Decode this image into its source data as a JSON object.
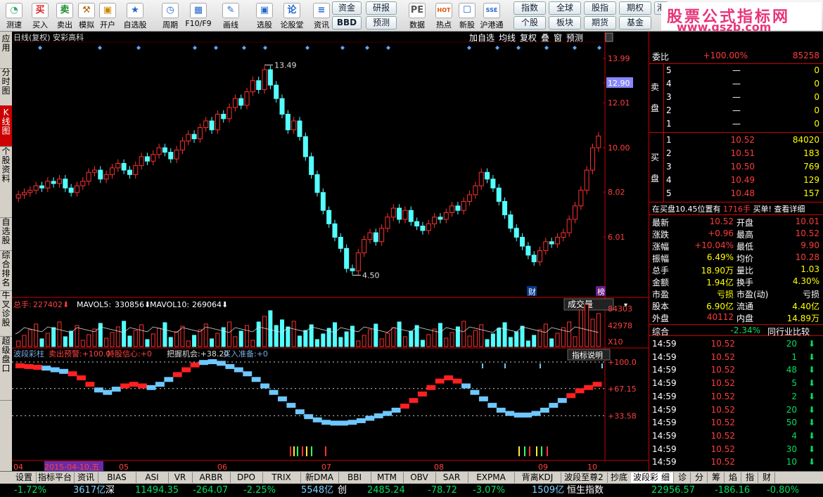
{
  "toolbar": {
    "items": [
      {
        "label": "测速",
        "icon": "speed-icon",
        "glyph": "◔",
        "color": "#3a6"
      },
      {
        "label": "买入",
        "icon": "buy-icon",
        "glyph": "买",
        "color": "#d22"
      },
      {
        "label": "卖出",
        "icon": "sell-icon",
        "glyph": "卖",
        "color": "#1a8a2a"
      },
      {
        "label": "模拟",
        "icon": "hammer-icon",
        "glyph": "⚒",
        "color": "#a60"
      },
      {
        "label": "开户",
        "icon": "lock-icon",
        "glyph": "▣",
        "color": "#c80"
      },
      {
        "label": "自选股",
        "icon": "star-icon",
        "glyph": "★",
        "color": "#26c"
      },
      {
        "label": "周期",
        "icon": "clock-icon",
        "glyph": "◷",
        "color": "#26c"
      },
      {
        "label": "F10/F9",
        "icon": "f10-icon",
        "glyph": "▦",
        "color": "#26c"
      },
      {
        "label": "画线",
        "icon": "pen-icon",
        "glyph": "✎",
        "color": "#26c"
      },
      {
        "label": "选股",
        "icon": "screen-icon",
        "glyph": "▣",
        "color": "#26c"
      },
      {
        "label": "论股堂",
        "icon": "forum-icon",
        "glyph": "论",
        "color": "#26c"
      },
      {
        "label": "资讯",
        "icon": "news-icon",
        "glyph": "≡",
        "color": "#26c"
      },
      {
        "label": "数据",
        "icon": "pe-icon",
        "glyph": "PE",
        "color": "#555"
      },
      {
        "label": "热点",
        "icon": "hot-icon",
        "glyph": "HOT",
        "color": "#d50"
      },
      {
        "label": "新股",
        "icon": "newstock-icon",
        "glyph": "☐",
        "color": "#26c"
      },
      {
        "label": "沪港通",
        "icon": "hk-connect-icon",
        "glyph": "SSE",
        "color": "#26c"
      }
    ],
    "buttons": [
      "资金",
      "研报",
      "BBD",
      "预测",
      "指数",
      "全球",
      "股指",
      "期权",
      "个股",
      "板块",
      "期货",
      "基金",
      "港"
    ]
  },
  "watermark": {
    "line1": "股票公式指标网",
    "line2": "www.gszb.com"
  },
  "left_tabs": [
    "应用",
    "分时图",
    "K线图",
    "个股资料",
    "自选股",
    "综合排名",
    "牛叉诊股",
    "超级盘口"
  ],
  "chart": {
    "title": "日线(复权) 安彩高科",
    "header_buttons": [
      "加自选",
      "均线",
      "复权",
      "叠",
      "窗",
      "预测"
    ],
    "price_axis": [
      "13.99",
      "12.90",
      "12.01",
      "10.00",
      "8.02",
      "6.01"
    ],
    "annotations": {
      "high": "13.49",
      "low": "4.50",
      "marker1": "财",
      "marker2": "榜"
    },
    "volume_header": {
      "label": "总手:",
      "total": "227402",
      "mavol5_label": "MAVOL5:",
      "mavol5": "330856",
      "mavol10_label": "MAVOL10:",
      "mavol10": "269064"
    },
    "volume_tab": "成交量",
    "volume_axis": [
      "84303",
      "42978",
      "X10"
    ],
    "indicator_header": {
      "name": "波段彩柱",
      "sell": "卖出预警:+100.0",
      "hold": "持股信心:+0",
      "wait": "把握机会:+38.20",
      "buy": "买入准备:+0"
    },
    "indicator_button": "指标说明",
    "indicator_axis": [
      "+100.0",
      "+67.15",
      "+33.58"
    ],
    "months": [
      "04",
      "2015-04-10,五",
      "05",
      "06",
      "07",
      "08",
      "09",
      "10"
    ]
  },
  "chart_data": {
    "type": "candlestick",
    "title": "日线(复权) 安彩高科",
    "xlabel": "",
    "ylabel": "",
    "ylim": [
      3.5,
      14.5
    ],
    "x": [
      "04",
      "05",
      "06",
      "07",
      "08",
      "09",
      "10"
    ],
    "series": [
      {
        "name": "总手",
        "values": [
          227402
        ]
      },
      {
        "name": "MAVOL5",
        "values": [
          330856
        ]
      },
      {
        "name": "MAVOL10",
        "values": [
          269064
        ]
      }
    ],
    "closes": [
      7.9,
      8.0,
      8.1,
      8.3,
      8.2,
      8.5,
      8.4,
      8.6,
      8.2,
      8.0,
      8.3,
      8.5,
      8.9,
      9.0,
      8.6,
      8.8,
      9.1,
      9.3,
      9.0,
      8.8,
      9.2,
      9.6,
      9.4,
      9.7,
      10.0,
      9.8,
      9.5,
      9.9,
      10.3,
      10.6,
      10.4,
      10.9,
      11.2,
      10.8,
      11.5,
      11.3,
      11.8,
      12.2,
      11.9,
      12.5,
      13.0,
      12.6,
      13.49,
      12.8,
      12.2,
      11.5,
      10.8,
      11.2,
      10.5,
      9.6,
      8.8,
      8.0,
      7.2,
      6.6,
      6.0,
      5.5,
      4.6,
      4.5,
      5.3,
      5.9,
      6.2,
      5.8,
      6.4,
      6.9,
      7.3,
      6.8,
      7.2,
      6.7,
      6.5,
      6.3,
      6.6,
      6.9,
      6.8,
      7.1,
      7.4,
      7.2,
      7.6,
      7.9,
      8.3,
      8.9,
      8.6,
      8.2,
      7.6,
      7.0,
      6.4,
      6.0,
      5.6,
      5.2,
      4.9,
      5.4,
      5.8,
      5.7,
      6.0,
      6.2,
      6.8,
      7.4,
      8.1,
      9.0,
      10.0,
      10.52
    ],
    "price_axis": [
      13.99,
      12.9,
      12.01,
      10.0,
      8.02,
      6.01
    ],
    "volume_axis": [
      84303,
      42978
    ],
    "indicator_axis": [
      100.0,
      67.15,
      33.58
    ],
    "indicator": [
      95,
      94,
      93,
      92,
      90,
      88,
      85,
      80,
      72,
      65,
      62,
      66,
      70,
      72,
      70,
      68,
      72,
      78,
      84,
      90,
      96,
      99,
      100,
      98,
      94,
      90,
      85,
      78,
      70,
      62,
      54,
      46,
      38,
      32,
      28,
      25,
      24,
      24,
      25,
      27,
      30,
      33,
      36,
      40,
      45,
      52,
      60,
      68,
      76,
      80,
      76,
      70,
      62,
      54,
      46,
      40,
      36,
      34,
      34,
      36,
      40,
      46,
      52,
      58,
      64,
      68,
      72
    ],
    "indicator_red_from_index": 55
  },
  "quote": {
    "wei_label": "委比",
    "wei_ratio": "+100.00%",
    "wei_diff": "85258",
    "sell_label": "卖盘",
    "buy_label": "买盘",
    "sell": [
      {
        "lv": "5",
        "p": "—",
        "v": "0"
      },
      {
        "lv": "4",
        "p": "—",
        "v": "0"
      },
      {
        "lv": "3",
        "p": "—",
        "v": "0"
      },
      {
        "lv": "2",
        "p": "—",
        "v": "0"
      },
      {
        "lv": "1",
        "p": "—",
        "v": "0"
      }
    ],
    "buy": [
      {
        "lv": "1",
        "p": "10.52",
        "v": "84020"
      },
      {
        "lv": "2",
        "p": "10.51",
        "v": "183"
      },
      {
        "lv": "3",
        "p": "10.50",
        "v": "769"
      },
      {
        "lv": "4",
        "p": "10.49",
        "v": "129"
      },
      {
        "lv": "5",
        "p": "10.48",
        "v": "157"
      }
    ],
    "notice": "在买盘10.45位置有",
    "notice_amt": "1716手",
    "notice_tail": "买单! 查看详细",
    "stats": [
      [
        "最新",
        "10.52",
        "开盘",
        "10.01"
      ],
      [
        "涨跌",
        "+0.96",
        "最高",
        "10.52"
      ],
      [
        "涨幅",
        "+10.04%",
        "最低",
        "9.90"
      ],
      [
        "振幅",
        "6.49%",
        "均价",
        "10.28"
      ],
      [
        "总手",
        "18.90万",
        "量比",
        "1.03"
      ],
      [
        "金额",
        "1.94亿",
        "换手",
        "4.30%"
      ],
      [
        "市盈",
        "亏损",
        "市盈(动)",
        "亏损"
      ],
      [
        "股本",
        "6.90亿",
        "流通",
        "4.40亿"
      ],
      [
        "外盘",
        "40112",
        "内盘",
        "14.89万"
      ]
    ],
    "sector_label": "综合",
    "sector_change": "-2.34%",
    "sector_btn": "同行业比较",
    "ticks": [
      [
        "14:59",
        "10.52",
        "20"
      ],
      [
        "14:59",
        "10.52",
        "1"
      ],
      [
        "14:59",
        "10.52",
        "48"
      ],
      [
        "14:59",
        "10.52",
        "5"
      ],
      [
        "14:59",
        "10.52",
        "2"
      ],
      [
        "14:59",
        "10.52",
        "20"
      ],
      [
        "14:59",
        "10.52",
        "50"
      ],
      [
        "14:59",
        "10.52",
        "4"
      ],
      [
        "14:59",
        "10.52",
        "30"
      ],
      [
        "14:59",
        "10.52",
        "10"
      ]
    ],
    "tick_arrow": "⬇"
  },
  "bottom_tabs": [
    "设置",
    "指标平台",
    "资讯",
    "BIAS",
    "ASI",
    "VR",
    "ARBR",
    "DPO",
    "TRIX",
    "新DMA",
    "BBI",
    "MTM",
    "OBV",
    "SAR",
    "EXPMA",
    "背离KDJ",
    "波段至尊2",
    "抄底",
    "波段彩柱"
  ],
  "right_tabs": [
    "细",
    "诊",
    "分",
    "筹",
    "焰",
    "指",
    "财"
  ],
  "status": [
    {
      "t": "-1.72%",
      "c": "g"
    },
    {
      "t": "3617亿",
      "c": "c"
    },
    {
      "t": "深",
      "c": "w"
    },
    {
      "t": "11494.35",
      "c": "g"
    },
    {
      "t": "-264.07",
      "c": "g"
    },
    {
      "t": "-2.25%",
      "c": "g"
    },
    {
      "t": "5548亿",
      "c": "c"
    },
    {
      "t": "创",
      "c": "w"
    },
    {
      "t": "2485.24",
      "c": "g"
    },
    {
      "t": "-78.72",
      "c": "g"
    },
    {
      "t": "-3.07%",
      "c": "g"
    },
    {
      "t": "1509亿",
      "c": "c"
    },
    {
      "t": "恒生指数",
      "c": "w"
    },
    {
      "t": "22956.57",
      "c": "g"
    },
    {
      "t": "-186.16",
      "c": "g"
    },
    {
      "t": "-0.80%",
      "c": "g"
    }
  ]
}
